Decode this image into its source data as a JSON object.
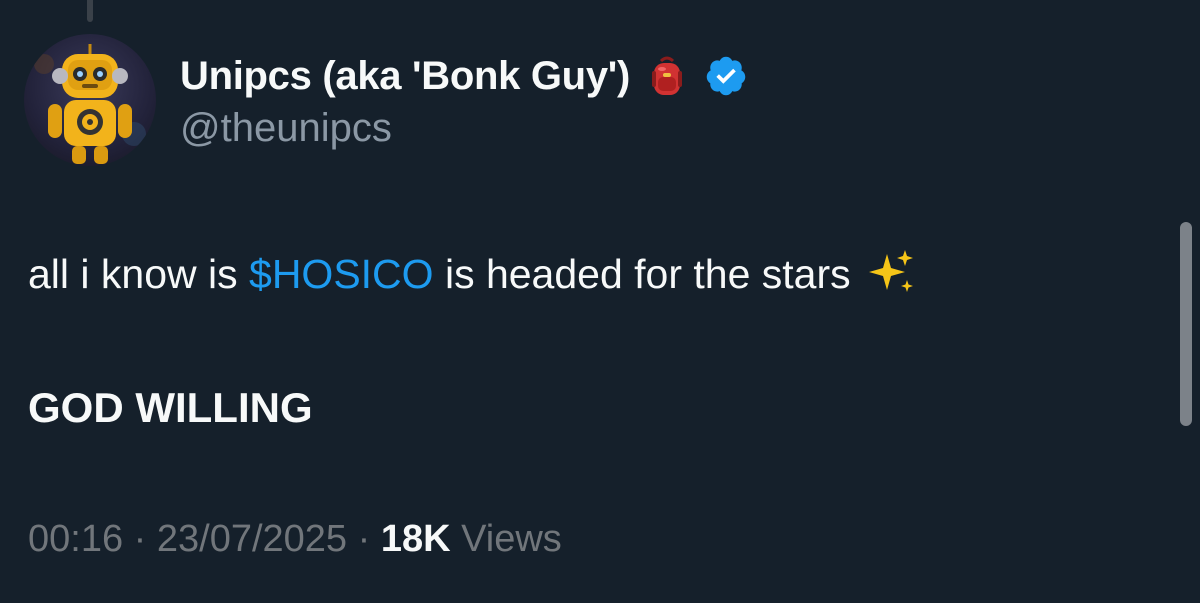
{
  "author": {
    "display_name": "Unipcs (aka 'Bonk Guy')",
    "handle": "@theunipcs",
    "name_emoji": "backpack-emoji-icon",
    "verified": true,
    "verified_icon": "verified-badge-icon",
    "avatar": "yellow-robot-avatar"
  },
  "tweet": {
    "line1_prefix": "all i know is ",
    "cashtag": "$HOSICO",
    "line1_suffix": " is headed for the stars",
    "line1_emoji": "sparkles-emoji-icon",
    "line2": "GOD WILLING"
  },
  "meta": {
    "time": "00:16",
    "separator": " · ",
    "date": "23/07/2025",
    "views_count": "18K",
    "views_label": " Views"
  },
  "colors": {
    "background": "#15202b",
    "text_primary": "#f7f9f9",
    "text_secondary": "#8b98a5",
    "meta_text": "#71767b",
    "link_blue": "#1d9bf0",
    "verified_blue": "#1d9bf0"
  }
}
